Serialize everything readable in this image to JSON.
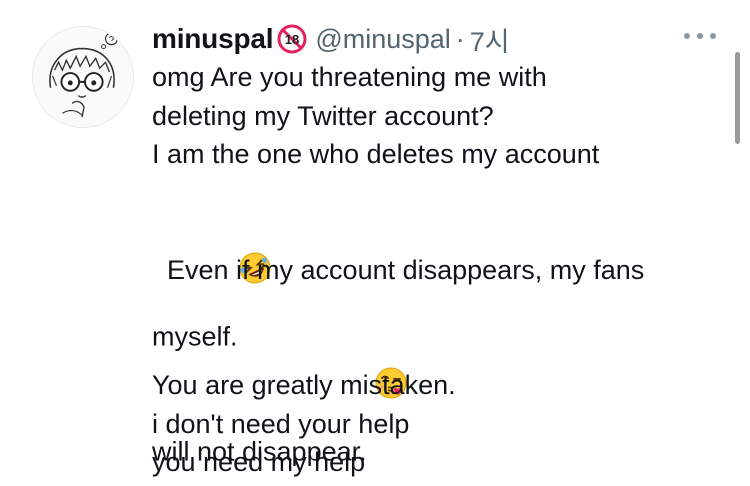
{
  "tweet": {
    "display_name": "minuspal",
    "badge_icon": "no-under-18-icon",
    "handle": "@minuspal",
    "separator": "·",
    "time": "7시",
    "menu_icon": "more-options-icon",
    "body_lines": [
      "omg Are you threatening me with",
      "deleting my Twitter account?",
      "I am the one who deletes my account",
      "myself.",
      "",
      "  Even if my account disappears, my fans",
      "will not disappear.",
      "",
      "You are greatly mistaken.",
      "i don't need your help",
      "you need my help"
    ],
    "emojis": {
      "line_3": "rolling-on-floor-laughing-emoji",
      "line_6": "face-blowing-kiss-emoji"
    }
  },
  "colors": {
    "text": "#0f1419",
    "secondary": "#536471",
    "badge_red": "#e0245e"
  }
}
